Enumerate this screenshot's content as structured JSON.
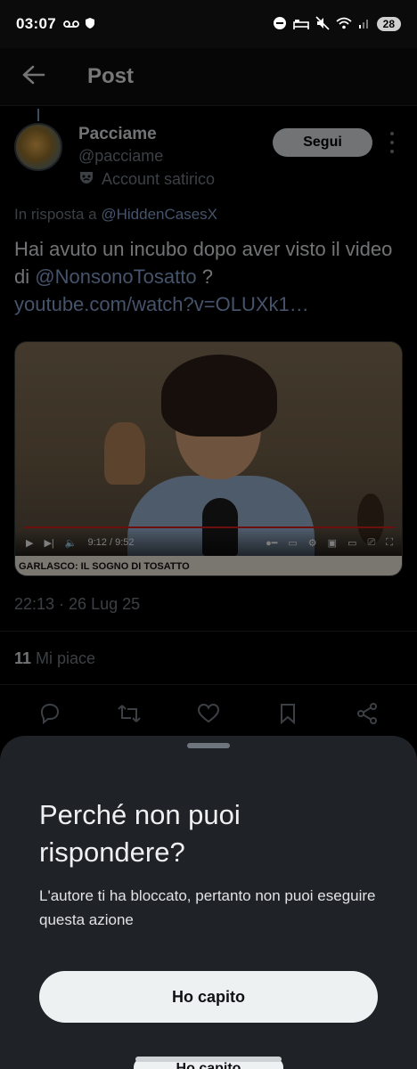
{
  "status_bar": {
    "time": "03:07",
    "battery": "28",
    "icons": [
      "voicemail-icon",
      "shield-icon",
      "dnd-icon",
      "sleep-icon",
      "mute-icon",
      "wifi-icon",
      "signal-icon"
    ]
  },
  "header": {
    "title": "Post",
    "back_icon": "arrow-left-icon"
  },
  "post": {
    "author_name": "Pacciame",
    "author_handle": "@pacciame",
    "author_label": "Account satirico",
    "follow_label": "Segui",
    "reply_prefix": "In risposta a",
    "reply_to": "@HiddenCasesX",
    "text_part1": "Hai avuto un incubo dopo aver visto  il video di ",
    "text_mention": "@NonsonoTosatto",
    "text_part2": " ?",
    "text_link": "youtube.com/watch?v=OLUXk1…",
    "card": {
      "video_time": "9:12 / 9:52",
      "caption": "GARLASCO: IL SOGNO DI TOSATTO"
    },
    "timestamp": "22:13 · 26 Lug 25",
    "likes_count": "11",
    "likes_label": "Mi piace",
    "actions": [
      "reply-icon",
      "retweet-icon",
      "like-icon",
      "bookmark-icon",
      "share-icon"
    ]
  },
  "sheet": {
    "title": "Perché non puoi rispondere?",
    "message": "L'autore ti ha bloccato, pertanto non puoi eseguire questa azione",
    "button_label": "Ho capito"
  },
  "colors": {
    "accent_link": "#7e98c4",
    "sheet_bg": "#1f2227",
    "button_bg": "#eef1f1"
  }
}
